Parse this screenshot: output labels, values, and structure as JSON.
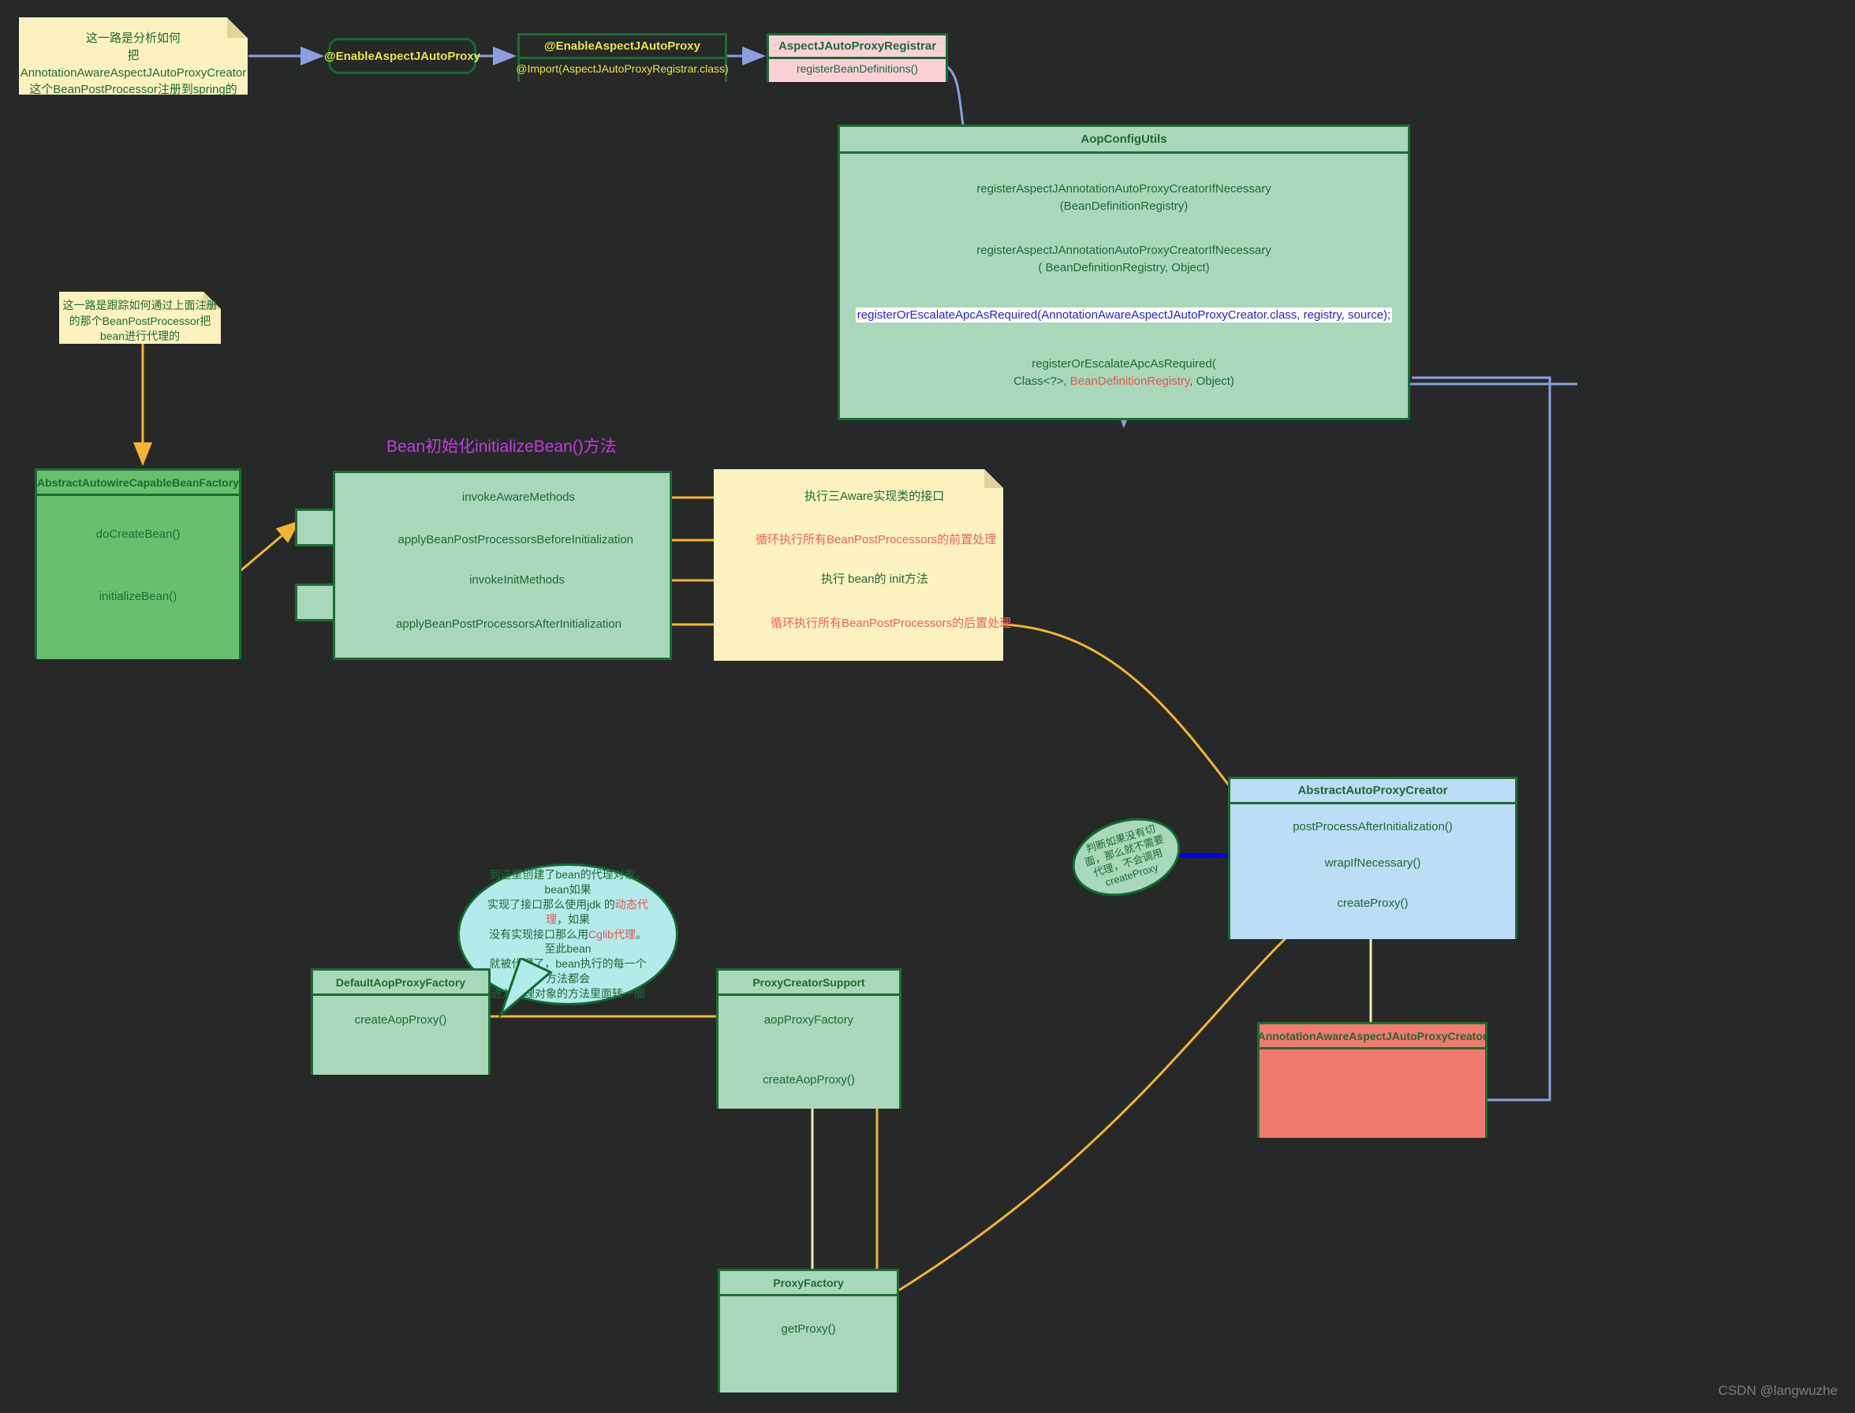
{
  "meta": {
    "background_color": "#262928",
    "accent_green": "#1e6b33",
    "accent_yellow_arrow": "#f5b335",
    "accent_blue_arrow": "#8c9ee0",
    "watermark": "CSDN @langwuzhe"
  },
  "notes": {
    "note_top": "这一路是分析如何\n把 AnnotationAwareAspectJAutoProxyCreator\n这个BeanPostProcessor注册到spring的",
    "note_left": "这一路是跟踪如何通过上面注册\n的那个BeanPostProcessor把\nbean进行代理的",
    "note_steps": [
      "执行三Aware实现类的接口",
      "循环执行所有BeanPostProcessors的前置处理",
      "执行 bean的 init方法",
      "循环执行所有BeanPostProcessors的后置处理"
    ]
  },
  "annotations": {
    "enable_aspectj_autoproxy": "@EnableAspectJAutoProxy",
    "section_title": "Bean初始化initializeBean()方法"
  },
  "ellipse_note": {
    "line1": "判断如果没有切",
    "line2": "面，那么就不需要",
    "line3": "代理，不会调用",
    "line4": "createProxy"
  },
  "bubble_note": {
    "seg1": "到这里创建了bean的代理对象。bean如果",
    "seg2": "实现了接口那么使用jdk 的",
    "seg3_red": "动态代理",
    "seg4": "，如果",
    "seg5": "没有实现接口那么用",
    "seg6_red": "Cglib代理",
    "seg7": "。至此bean",
    "seg8": "就被代理了，bean执行的每一个方法都会",
    "seg9": "进入代理对象的方法里面转一圈"
  },
  "classes": {
    "enable_aspectj_class": {
      "title": "@EnableAspectJAutoProxy",
      "members": [
        "@Import(AspectJAutoProxyRegistrar.class)"
      ]
    },
    "aspectj_registrar": {
      "title": "AspectJAutoProxyRegistrar",
      "members": [
        "registerBeanDefinitions()"
      ]
    },
    "aop_config_utils": {
      "title": "AopConfigUtils",
      "members": [
        {
          "line1": "registerAspectJAnnotationAutoProxyCreatorIfNecessary",
          "line2": "(BeanDefinitionRegistry)"
        },
        {
          "line1": "registerAspectJAnnotationAutoProxyCreatorIfNecessary",
          "line2": "( BeanDefinitionRegistry, Object)"
        },
        {
          "highlight": "registerOrEscalateApcAsRequired(AnnotationAwareAspectJAutoProxyCreator.class, registry, source);"
        },
        {
          "line1": "registerOrEscalateApcAsRequired(",
          "line2_a": "Class<?>, ",
          "line2_red": "BeanDefinitionRegistry",
          "line2_b": ", Object)"
        }
      ]
    },
    "abstract_autowire_factory": {
      "title": "AbstractAutowireCapableBeanFactory",
      "members": [
        "doCreateBean()",
        "initializeBean()"
      ]
    },
    "initialize_bean_box": {
      "members": [
        "invokeAwareMethods",
        "applyBeanPostProcessorsBeforeInitialization",
        "invokeInitMethods",
        "applyBeanPostProcessorsAfterInitialization"
      ]
    },
    "abstract_auto_proxy_creator": {
      "title": "AbstractAutoProxyCreator",
      "members": [
        "postProcessAfterInitialization()",
        "wrapIfNecessary()",
        "createProxy()"
      ]
    },
    "annotation_aware_creator": {
      "title": "AnnotationAwareAspectJAutoProxyCreator",
      "members": []
    },
    "default_aop_proxy_factory": {
      "title": "DefaultAopProxyFactory",
      "members": [
        "createAopProxy()"
      ]
    },
    "proxy_creator_support": {
      "title": "ProxyCreatorSupport",
      "members": [
        "aopProxyFactory",
        "createAopProxy()"
      ]
    },
    "proxy_factory": {
      "title": "ProxyFactory",
      "members": [
        "getProxy()"
      ]
    }
  }
}
